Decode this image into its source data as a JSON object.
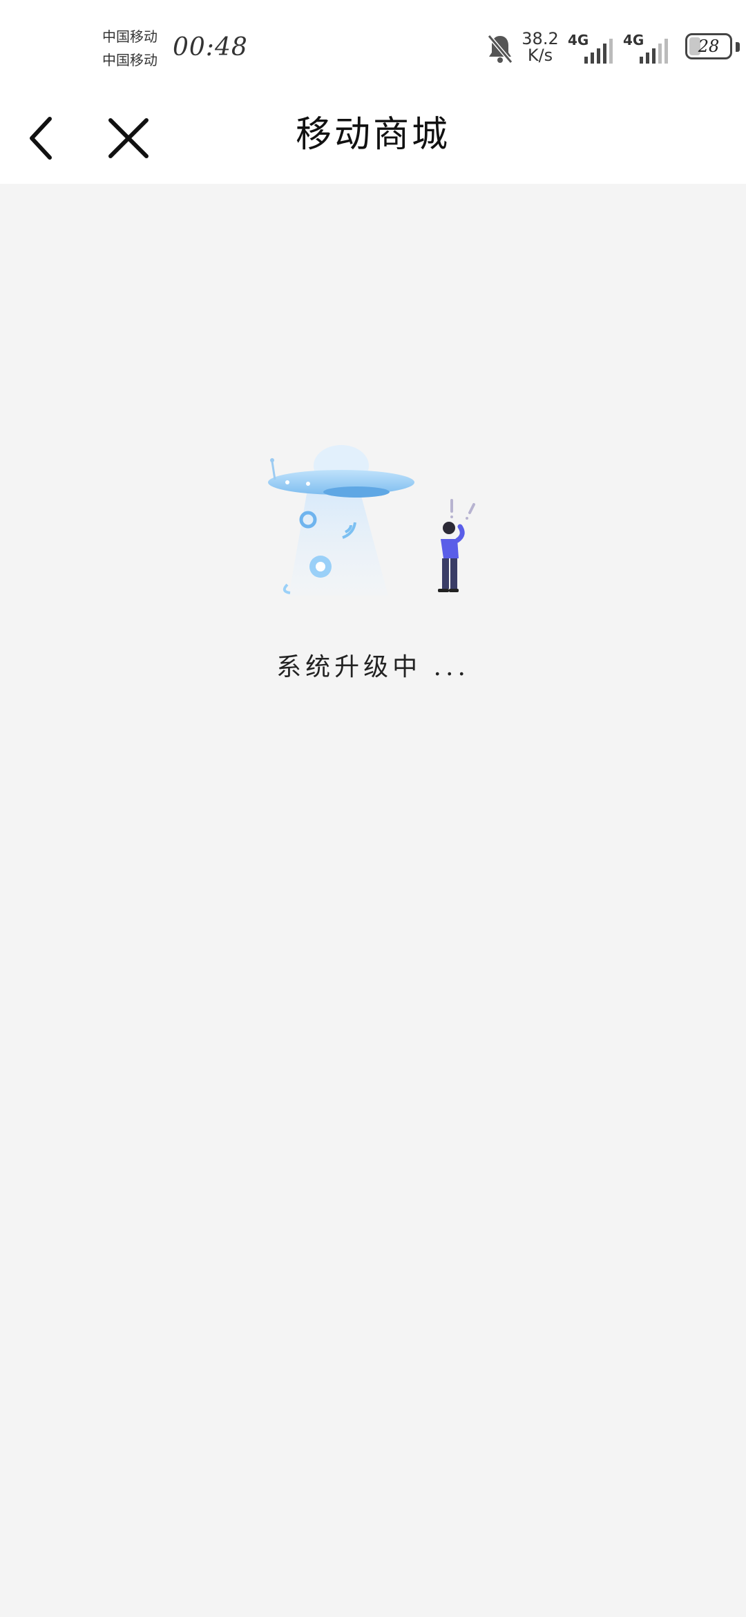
{
  "status_bar": {
    "carrier_1": "中国移动",
    "carrier_2": "中国移动",
    "time": "00:48",
    "speed_value": "38.2",
    "speed_unit": "K/s",
    "network_1": "4G",
    "network_2": "4G",
    "battery": "28",
    "icons": [
      "bell-muted-icon",
      "signal-icon",
      "battery-icon"
    ]
  },
  "nav": {
    "title": "移动商城",
    "icons": [
      "chevron-left-icon",
      "close-icon"
    ]
  },
  "main": {
    "message": "系统升级中 ...",
    "illustration": "ufo-illustration"
  },
  "colors": {
    "background": "#f4f4f4",
    "header": "#ffffff",
    "ufo": "#8cc8f4",
    "person_shirt": "#5a5ee8"
  }
}
